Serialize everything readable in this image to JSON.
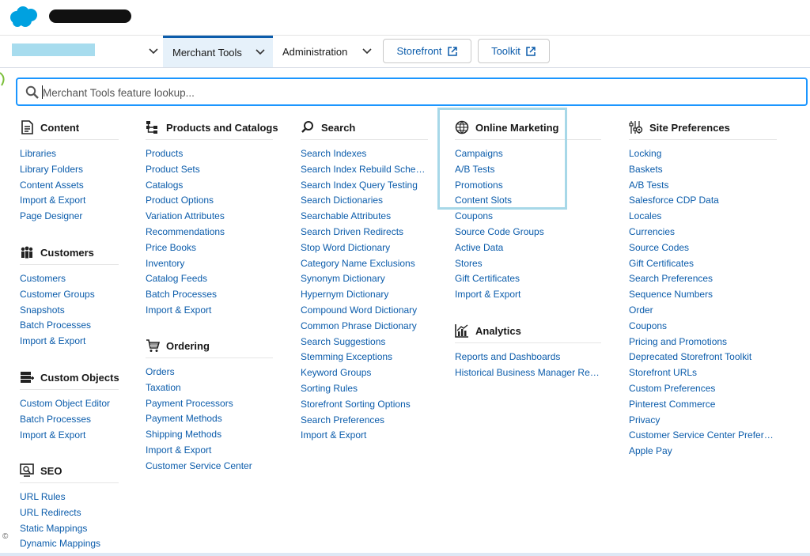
{
  "header": {
    "logo_icon": "salesforce-cloud-icon",
    "brand_color": "#00a1e0"
  },
  "nav": {
    "tabs": [
      {
        "label": "Merchant Tools",
        "active": true
      },
      {
        "label": "Administration",
        "active": false
      }
    ],
    "storefront_label": "Storefront",
    "toolkit_label": "Toolkit"
  },
  "search": {
    "placeholder": "Merchant Tools feature lookup..."
  },
  "groups": {
    "content": {
      "title": "Content",
      "icon": "document-icon",
      "items": [
        "Libraries",
        "Library Folders",
        "Content Assets",
        "Import & Export",
        "Page Designer"
      ]
    },
    "customers": {
      "title": "Customers",
      "icon": "people-icon",
      "items": [
        "Customers",
        "Customer Groups",
        "Snapshots",
        "Batch Processes",
        "Import & Export"
      ]
    },
    "custom_objects": {
      "title": "Custom Objects",
      "icon": "database-icon",
      "items": [
        "Custom Object Editor",
        "Batch Processes",
        "Import & Export"
      ]
    },
    "seo": {
      "title": "SEO",
      "icon": "seo-icon",
      "items": [
        "URL Rules",
        "URL Redirects",
        "Static Mappings",
        "Dynamic Mappings"
      ]
    },
    "products": {
      "title": "Products and Catalogs",
      "icon": "hierarchy-icon",
      "items": [
        "Products",
        "Product Sets",
        "Catalogs",
        "Product Options",
        "Variation Attributes",
        "Recommendations",
        "Price Books",
        "Inventory",
        "Catalog Feeds",
        "Batch Processes",
        "Import & Export"
      ]
    },
    "ordering": {
      "title": "Ordering",
      "icon": "cart-icon",
      "items": [
        "Orders",
        "Taxation",
        "Payment Processors",
        "Payment Methods",
        "Shipping Methods",
        "Import & Export",
        "Customer Service Center"
      ]
    },
    "search": {
      "title": "Search",
      "icon": "search-icon",
      "items": [
        "Search Indexes",
        "Search Index Rebuild Schedule",
        "Search Index Query Testing",
        "Search Dictionaries",
        "Searchable Attributes",
        "Search Driven Redirects",
        "Stop Word Dictionary",
        "Category Name Exclusions",
        "Synonym Dictionary",
        "Hypernym Dictionary",
        "Compound Word Dictionary",
        "Common Phrase Dictionary",
        "Search Suggestions",
        "Stemming Exceptions",
        "Keyword Groups",
        "Sorting Rules",
        "Storefront Sorting Options",
        "Search Preferences",
        "Import & Export"
      ]
    },
    "online_marketing": {
      "title": "Online Marketing",
      "icon": "globe-icon",
      "items": [
        "Campaigns",
        "A/B Tests",
        "Promotions",
        "Content Slots",
        "Coupons",
        "Source Code Groups",
        "Active Data",
        "Stores",
        "Gift Certificates",
        "Import & Export"
      ]
    },
    "analytics": {
      "title": "Analytics",
      "icon": "chart-icon",
      "items": [
        "Reports and Dashboards",
        "Historical Business Manager Repo..."
      ]
    },
    "site_preferences": {
      "title": "Site Preferences",
      "icon": "settings-sliders-icon",
      "items": [
        "Locking",
        "Baskets",
        "A/B Tests",
        "Salesforce CDP Data",
        "Locales",
        "Currencies",
        "Source Codes",
        "Gift Certificates",
        "Search Preferences",
        "Sequence Numbers",
        "Order",
        "Coupons",
        "Pricing and Promotions",
        "Deprecated Storefront Toolkit",
        "Storefront URLs",
        "Custom Preferences",
        "Pinterest Commerce",
        "Privacy",
        "Customer Service Center Preferen...",
        "Apple Pay"
      ]
    }
  },
  "colors": {
    "link": "#0b5cab",
    "focus": "#1b96ff",
    "highlight": "#a7d8e8",
    "active_tab_bg": "#e6f1fa"
  }
}
